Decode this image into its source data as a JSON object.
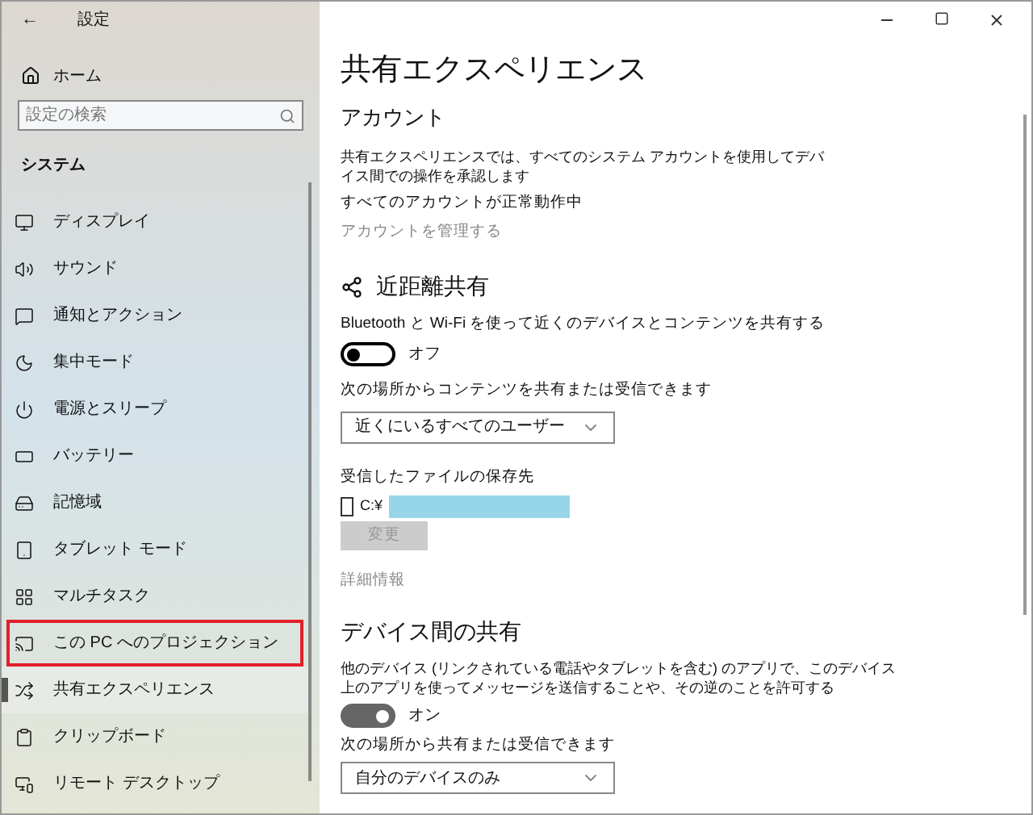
{
  "window": {
    "title": "設定",
    "back": "←"
  },
  "sidebar": {
    "home": "ホーム",
    "search": {
      "placeholder": "設定の検索"
    },
    "section": "システム",
    "items": [
      {
        "label": "ディスプレイ",
        "selected": false,
        "highlighted": false
      },
      {
        "label": "サウンド",
        "selected": false,
        "highlighted": false
      },
      {
        "label": "通知とアクション",
        "selected": false,
        "highlighted": false
      },
      {
        "label": "集中モード",
        "selected": false,
        "highlighted": false
      },
      {
        "label": "電源とスリープ",
        "selected": false,
        "highlighted": false
      },
      {
        "label": "バッテリー",
        "selected": false,
        "highlighted": false
      },
      {
        "label": "記憶域",
        "selected": false,
        "highlighted": false
      },
      {
        "label": "タブレット モード",
        "selected": false,
        "highlighted": false
      },
      {
        "label": "マルチタスク",
        "selected": false,
        "highlighted": false
      },
      {
        "label": "この PC へのプロジェクション",
        "selected": false,
        "highlighted": true
      },
      {
        "label": "共有エクスペリエンス",
        "selected": true,
        "highlighted": false
      },
      {
        "label": "クリップボード",
        "selected": false,
        "highlighted": false
      },
      {
        "label": "リモート デスクトップ",
        "selected": false,
        "highlighted": false
      }
    ]
  },
  "page": {
    "title": "共有エクスペリエンス",
    "account": {
      "heading": "アカウント",
      "description": "共有エクスペリエンスでは、すべてのシステム アカウントを使用してデバイス間での操作を承認します",
      "status": "すべてのアカウントが正常動作中",
      "link": "アカウントを管理する"
    },
    "nearby": {
      "heading": "近距離共有",
      "description": "Bluetooth と Wi-Fi を使って近くのデバイスとコンテンツを共有する",
      "toggle": {
        "on": false,
        "label": "オフ"
      },
      "share_label": "次の場所からコンテンツを共有または受信できます",
      "dropdown": "近くにいるすべてのユーザー",
      "save_label": "受信したファイルの保存先",
      "path": "C:¥",
      "change_button": {
        "label": "変更",
        "disabled": true
      },
      "more_info": "詳細情報"
    },
    "cross_device": {
      "heading": "デバイス間の共有",
      "description": "他のデバイス (リンクされている電話やタブレットを含む) のアプリで、このデバイス上のアプリを使ってメッセージを送信することや、その逆のことを許可する",
      "toggle": {
        "on": true,
        "label": "オン"
      },
      "share_label": "次の場所から共有または受信できます",
      "dropdown": "自分のデバイスのみ"
    }
  }
}
